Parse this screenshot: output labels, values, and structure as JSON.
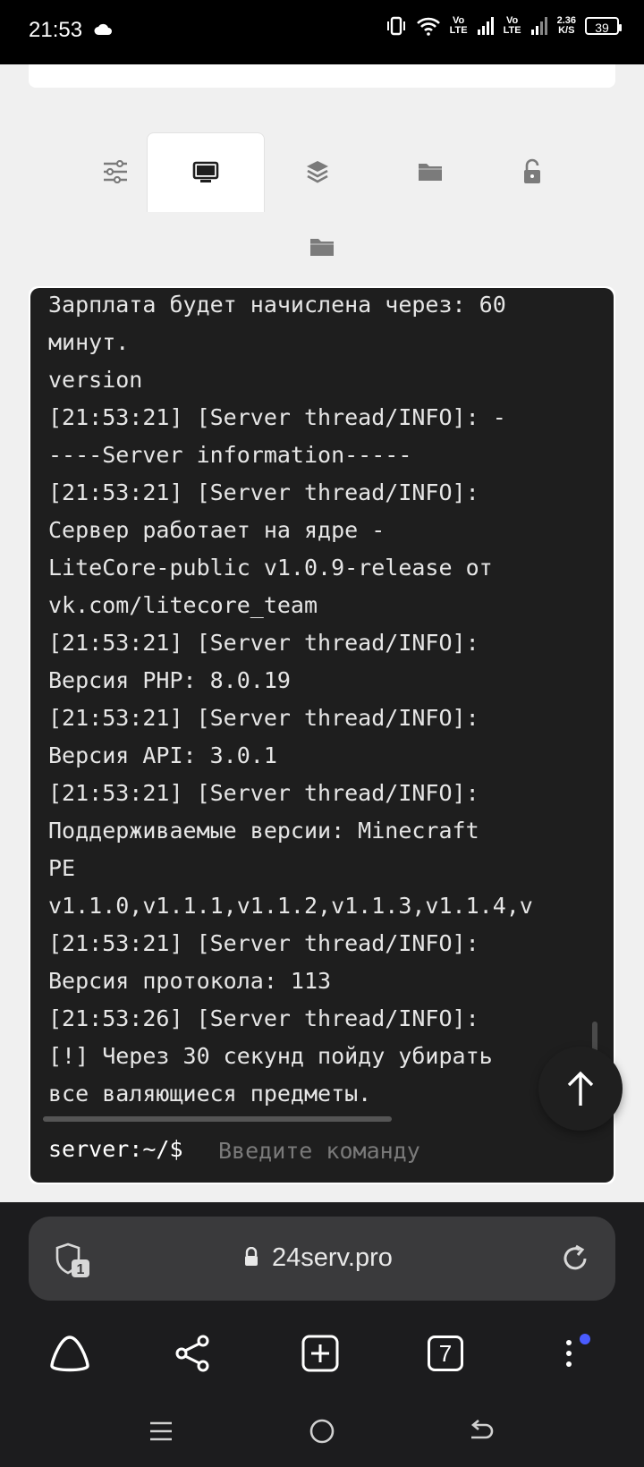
{
  "status_bar": {
    "time": "21:53",
    "net1": "Vo\nLTE",
    "net2": "Vo\nLTE",
    "speed": "2.36\nK/S",
    "battery": "39"
  },
  "tabs": [
    {
      "icon": "sliders-icon"
    },
    {
      "icon": "monitor-icon",
      "active": true
    },
    {
      "icon": "layers-icon"
    },
    {
      "icon": "folder-icon"
    },
    {
      "icon": "unlock-icon"
    },
    {
      "icon": "folder-icon"
    }
  ],
  "console": {
    "log": "Зарплата будет начислена через: 60\nминут.\nversion\n[21:53:21] [Server thread/INFO]: -\n----Server information-----\n[21:53:21] [Server thread/INFO]:\nСервер работает на ядре -\nLiteCore-public v1.0.9-release от\nvk.com/litecore_team\n[21:53:21] [Server thread/INFO]:\nВерсия PHP: 8.0.19\n[21:53:21] [Server thread/INFO]:\nВерсия API: 3.0.1\n[21:53:21] [Server thread/INFO]:\nПоддерживаемые версии: Minecraft\nPE\nv1.1.0,v1.1.1,v1.1.2,v1.1.3,v1.1.4,v\n[21:53:21] [Server thread/INFO]:\nВерсия протокола: 113\n[21:53:26] [Server thread/INFO]:\n[!] Через 30 секунд пойду убирать\nвсе валяющиеся предметы.",
    "prompt": "server:~/$",
    "input_placeholder": "Введите команду"
  },
  "browser": {
    "url": "24serv.pro",
    "shield_badge": "1",
    "tab_count": "7"
  }
}
